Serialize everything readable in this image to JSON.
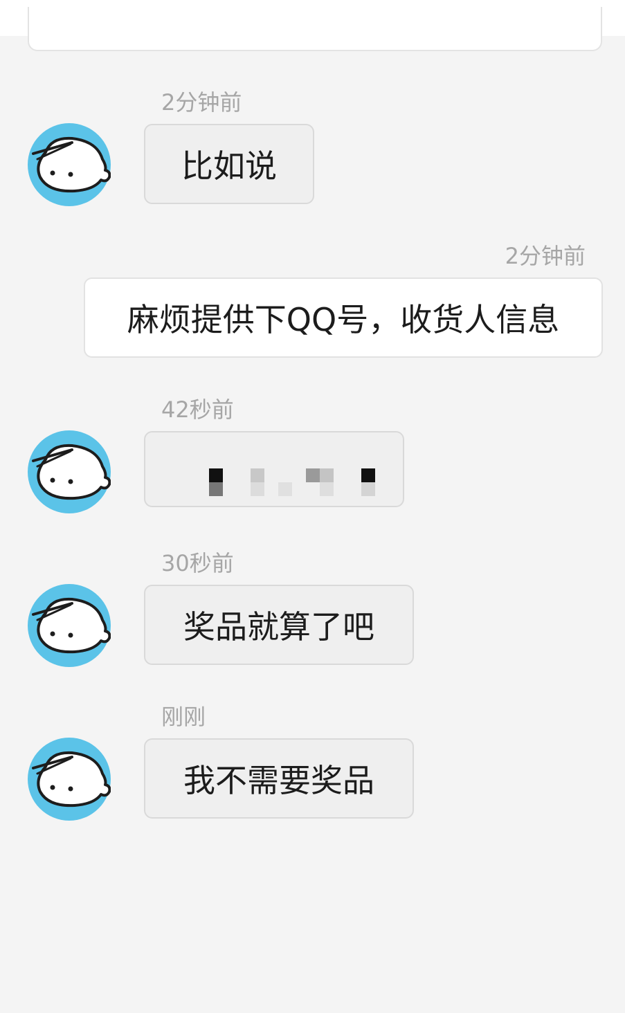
{
  "chat": {
    "messages": [
      {
        "sender": "other",
        "time": "2分钟前",
        "text": "比如说"
      },
      {
        "sender": "self",
        "time": "2分钟前",
        "text": "麻烦提供下QQ号，收货人信息"
      },
      {
        "sender": "other",
        "time": "42秒前",
        "text": "",
        "note": "redacted"
      },
      {
        "sender": "other",
        "time": "30秒前",
        "text": "奖品就算了吧"
      },
      {
        "sender": "other",
        "time": "刚刚",
        "text": "我不需要奖品"
      }
    ]
  },
  "colors": {
    "background": "#f4f4f4",
    "incoming_bubble": "#efefef",
    "outgoing_bubble": "#ffffff",
    "avatar_ring": "#5bc3e8",
    "timestamp": "#a6a6a6"
  },
  "icons": {
    "avatar": "cartoon-face-avatar"
  }
}
